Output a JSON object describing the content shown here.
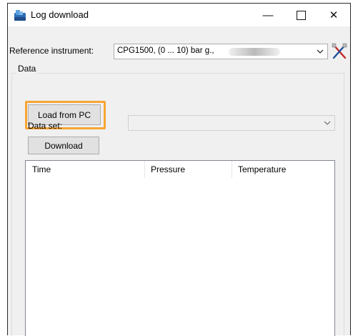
{
  "window": {
    "title": "Log download",
    "controls": {
      "minimize": "—",
      "close": "✕"
    }
  },
  "reference": {
    "label": "Reference instrument:",
    "value": "CPG1500, (0 ... 10) bar g.,"
  },
  "data_group": {
    "title": "Data",
    "load_button": "Load from PC",
    "dataset_label": "Data set:",
    "dataset_value": "",
    "download_button": "Download",
    "columns": [
      "Time",
      "Pressure",
      "Temperature"
    ]
  },
  "colors": {
    "highlight": "#f7a535",
    "window_bg": "#f0f0f0"
  },
  "icons": [
    "app-icon",
    "chevron-down-icon",
    "instrument-tool-icon"
  ]
}
